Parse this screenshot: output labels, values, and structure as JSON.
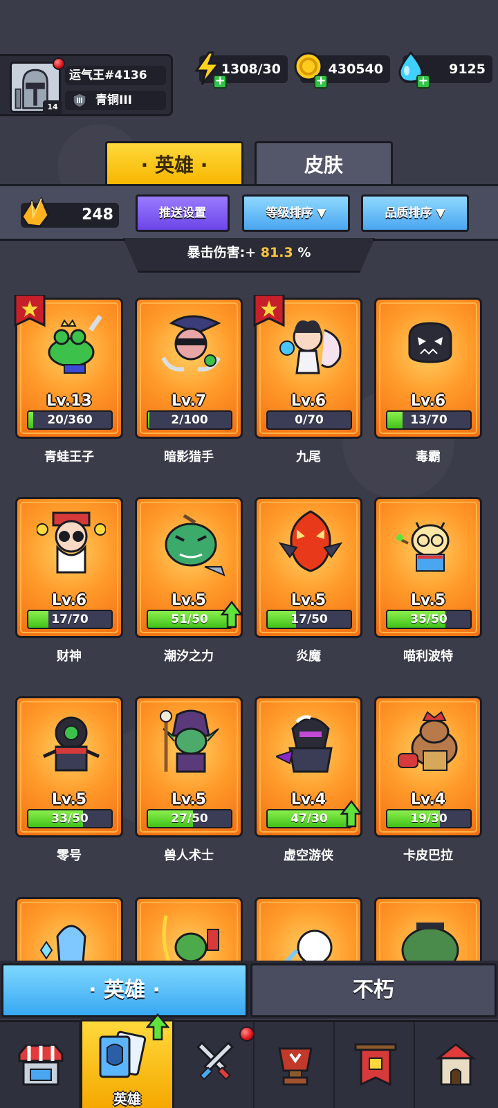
{
  "player": {
    "name": "运气王#4136",
    "level": "14",
    "rank": "青铜III"
  },
  "currencies": {
    "energy": "1308/30",
    "gold": "430540",
    "gems": "9125"
  },
  "tabs": {
    "heroes": "· 英雄 ·",
    "skins": "皮肤"
  },
  "controls": {
    "shards": "248",
    "push_settings": "推送设置",
    "level_sort": "等级排序",
    "quality_sort": "品质排序"
  },
  "crit": {
    "label": "暴击伤害:+",
    "value": "81.3",
    "unit": "%"
  },
  "heroes": [
    {
      "name": "青蛙王子",
      "level": "Lv.13",
      "progress": "20/360",
      "fill": 0.056,
      "badge": true,
      "upgrade": false
    },
    {
      "name": "暗影猎手",
      "level": "Lv.7",
      "progress": "2/100",
      "fill": 0.02,
      "badge": false,
      "upgrade": false
    },
    {
      "name": "九尾",
      "level": "Lv.6",
      "progress": "0/70",
      "fill": 0,
      "badge": true,
      "upgrade": false
    },
    {
      "name": "毒霸",
      "level": "Lv.6",
      "progress": "13/70",
      "fill": 0.186,
      "badge": false,
      "upgrade": false
    },
    {
      "name": "财神",
      "level": "Lv.6",
      "progress": "17/70",
      "fill": 0.243,
      "badge": false,
      "upgrade": false
    },
    {
      "name": "潮汐之力",
      "level": "Lv.5",
      "progress": "51/50",
      "fill": 1,
      "badge": false,
      "upgrade": true
    },
    {
      "name": "炎魔",
      "level": "Lv.5",
      "progress": "17/50",
      "fill": 0.34,
      "badge": false,
      "upgrade": false
    },
    {
      "name": "喵利波特",
      "level": "Lv.5",
      "progress": "35/50",
      "fill": 0.7,
      "badge": false,
      "upgrade": false
    },
    {
      "name": "零号",
      "level": "Lv.5",
      "progress": "33/50",
      "fill": 0.66,
      "badge": false,
      "upgrade": false
    },
    {
      "name": "兽人术士",
      "level": "Lv.5",
      "progress": "27/50",
      "fill": 0.54,
      "badge": false,
      "upgrade": false
    },
    {
      "name": "虚空游侠",
      "level": "Lv.4",
      "progress": "47/30",
      "fill": 1,
      "badge": false,
      "upgrade": true
    },
    {
      "name": "卡皮巴拉",
      "level": "Lv.4",
      "progress": "19/30",
      "fill": 0.633,
      "badge": false,
      "upgrade": false
    }
  ],
  "subtabs": {
    "heroes": "· 英雄 ·",
    "immortal": "不朽"
  },
  "nav": {
    "heroes_label": "英雄"
  },
  "colors": {
    "accent_yellow": "#ffd93b",
    "accent_blue": "#4aa6f0",
    "card_orange": "#f26d11",
    "progress_green": "#41c21a"
  }
}
